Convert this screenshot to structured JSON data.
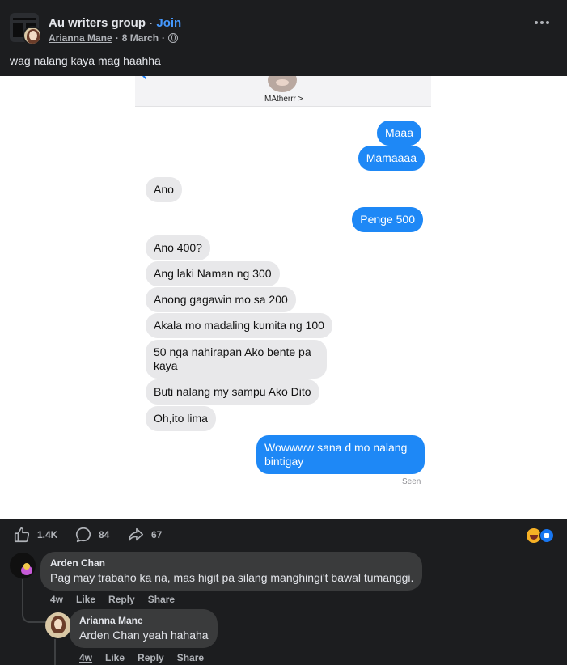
{
  "post": {
    "group_name": "Au writers group",
    "separator": "·",
    "join_label": "Join",
    "author": "Arianna Mane",
    "date": "8 March",
    "caption": "wag nalang kaya mag haahha"
  },
  "screenshot": {
    "contact_name": "MAtherrr >",
    "messages": [
      {
        "side": "sent",
        "text": "Maaa"
      },
      {
        "side": "sent",
        "text": "Mamaaaa"
      },
      {
        "side": "recv",
        "text": "Ano"
      },
      {
        "side": "sent",
        "text": "Penge 500"
      },
      {
        "side": "recv",
        "text": "Ano 400?"
      },
      {
        "side": "recv",
        "text": "Ang laki Naman ng 300"
      },
      {
        "side": "recv",
        "text": "Anong gagawin mo sa 200"
      },
      {
        "side": "recv",
        "text": "Akala mo madaling kumita ng 100"
      },
      {
        "side": "recv",
        "text": "50 nga nahirapan Ako bente pa kaya"
      },
      {
        "side": "recv",
        "text": "Buti nalang my sampu Ako Dito"
      },
      {
        "side": "recv",
        "text": "Oh,ito lima"
      },
      {
        "side": "sent",
        "text": "Wowwww sana d mo nalang bintigay"
      }
    ],
    "seen_label": "Seen"
  },
  "stats": {
    "likes": "1.4K",
    "comments": "84",
    "shares": "67"
  },
  "comments": [
    {
      "author": "Arden Chan",
      "text": "Pag may trabaho ka na, mas higit pa silang manghingi't bawal tumanggi.",
      "time": "4w",
      "like": "Like",
      "reply": "Reply",
      "share": "Share"
    },
    {
      "author": "Arianna Mane",
      "text": "Arden Chan yeah hahaha",
      "time": "4w",
      "like": "Like",
      "reply": "Reply",
      "share": "Share"
    }
  ],
  "colors": {
    "join": "#4599ff",
    "sent_bubble": "#1e88f6",
    "recv_bubble": "#e8e8ea",
    "like_reaction": "#1877f2",
    "haha_reaction": "#f7b125"
  }
}
